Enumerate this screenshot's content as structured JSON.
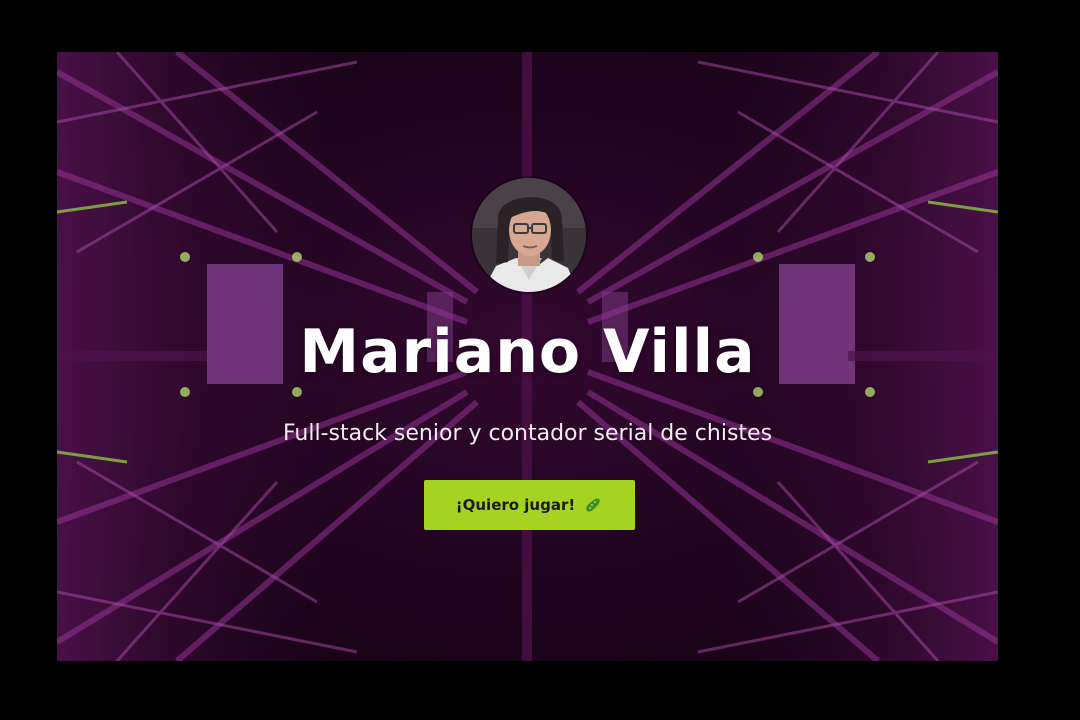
{
  "profile": {
    "name": "Mariano Villa",
    "tagline": "Full-stack senior y contador serial de chistes",
    "avatar_icon": "portrait-avatar"
  },
  "cta": {
    "label": "¡Quiero jugar!",
    "icon": "pickle-icon",
    "color": "#a6d321"
  },
  "theme": {
    "background": "#000000",
    "accent_purple": "#b03ab5",
    "accent_green": "#9ee04a"
  }
}
